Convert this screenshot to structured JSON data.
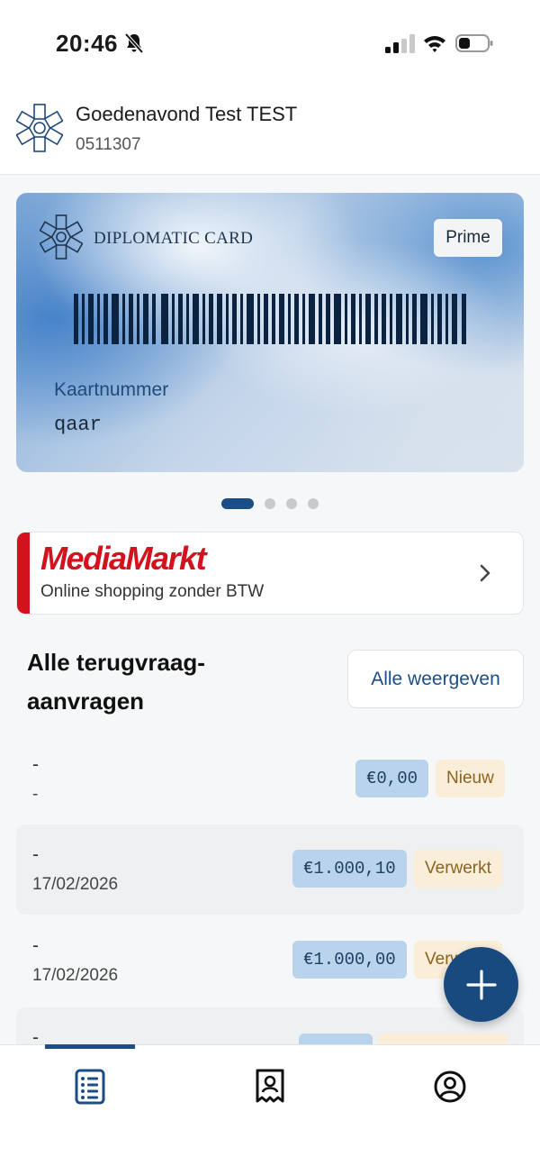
{
  "status_bar": {
    "time": "20:46",
    "icons": [
      "bell-off-icon",
      "signal-icon",
      "wifi-icon",
      "battery-icon"
    ]
  },
  "header": {
    "greeting": "Goedenavond Test TEST",
    "member_id": "0511307"
  },
  "card": {
    "brand": "DIPLOMATIC CARD",
    "tier": "Prime",
    "number_label": "Kaartnummer",
    "number_value": "qaar",
    "pager": {
      "total": 4,
      "active": 1
    }
  },
  "promo": {
    "logo_text": "MediaMarkt",
    "tagline": "Online shopping zonder BTW",
    "colors": {
      "brand": "#d2121d"
    }
  },
  "claims": {
    "title": "Alle terugvraag-aanvragen",
    "view_all_label": "Alle weergeven",
    "rows": [
      {
        "title": "-",
        "date": "-",
        "amount": "€0,00",
        "status": "Nieuw"
      },
      {
        "title": "-",
        "date": "17/02/2026",
        "amount": "€1.000,10",
        "status": "Verwerkt"
      },
      {
        "title": "-",
        "date": "17/02/2026",
        "amount": "€1.000,00",
        "status": "Verwerkt"
      },
      {
        "title": "-",
        "date": "",
        "amount": "",
        "status": ""
      }
    ]
  },
  "fab": {
    "icon": "plus-icon"
  },
  "bottom_nav": {
    "items": [
      {
        "icon": "list-icon",
        "active": true
      },
      {
        "icon": "receipt-icon",
        "active": false
      },
      {
        "icon": "profile-icon",
        "active": false
      }
    ]
  },
  "colors": {
    "primary": "#1b4e87",
    "amount_badge_bg": "#b9d3ec",
    "status_badge_bg": "#fbeed8"
  }
}
